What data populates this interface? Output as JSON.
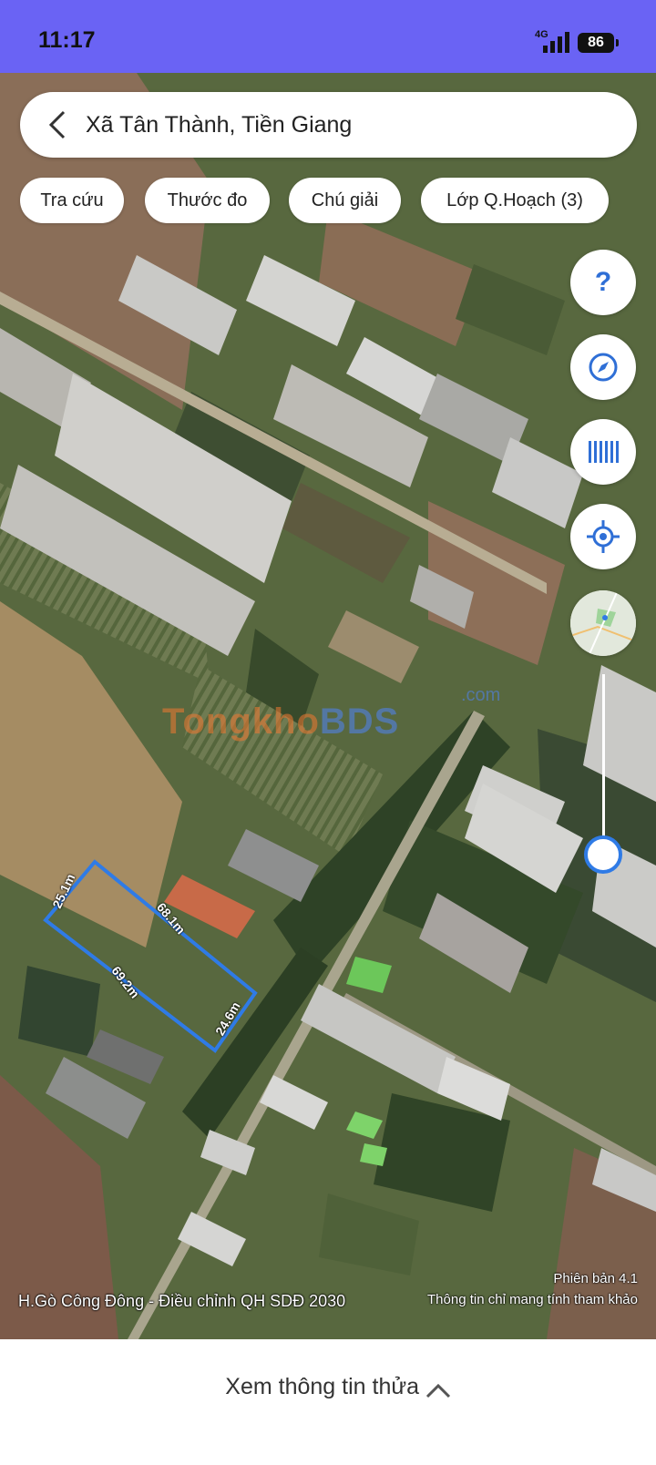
{
  "status_bar": {
    "time": "11:17",
    "network": "4G",
    "battery": "86"
  },
  "search": {
    "location": "Xã Tân Thành, Tiền Giang",
    "back_icon": "chevron-left-icon"
  },
  "chips": [
    {
      "label": "Tra cứu"
    },
    {
      "label": "Thước đo"
    },
    {
      "label": "Chú giải"
    },
    {
      "label": "Lớp Q.Hoạch (3)"
    }
  ],
  "controls": {
    "help": {
      "icon": "help-icon",
      "glyph": "?"
    },
    "compass": {
      "icon": "compass-icon"
    },
    "barcode": {
      "icon": "barcode-icon"
    },
    "locate": {
      "icon": "locate-icon"
    },
    "minimap": {
      "icon": "minimap-thumbnail"
    }
  },
  "parcel": {
    "edges": [
      "25.1m",
      "68.1m",
      "69.2m",
      "24.6m"
    ],
    "outline_color": "#2f7be6"
  },
  "watermark": {
    "brand_a": "Tongkho",
    "brand_b": "BDS",
    "suffix": ".com"
  },
  "map_footer": {
    "source": "H.Gò Công Đông - Điều chỉnh QH SDĐ 2030",
    "version": "Phiên bản 4.1",
    "disclaimer": "Thông tin chỉ mang tính tham khảo"
  },
  "bottom": {
    "label": "Xem thông tin thửa",
    "icon": "chevron-up-icon"
  },
  "colors": {
    "accent": "#6a63f4",
    "control_blue": "#2f6fd6"
  }
}
